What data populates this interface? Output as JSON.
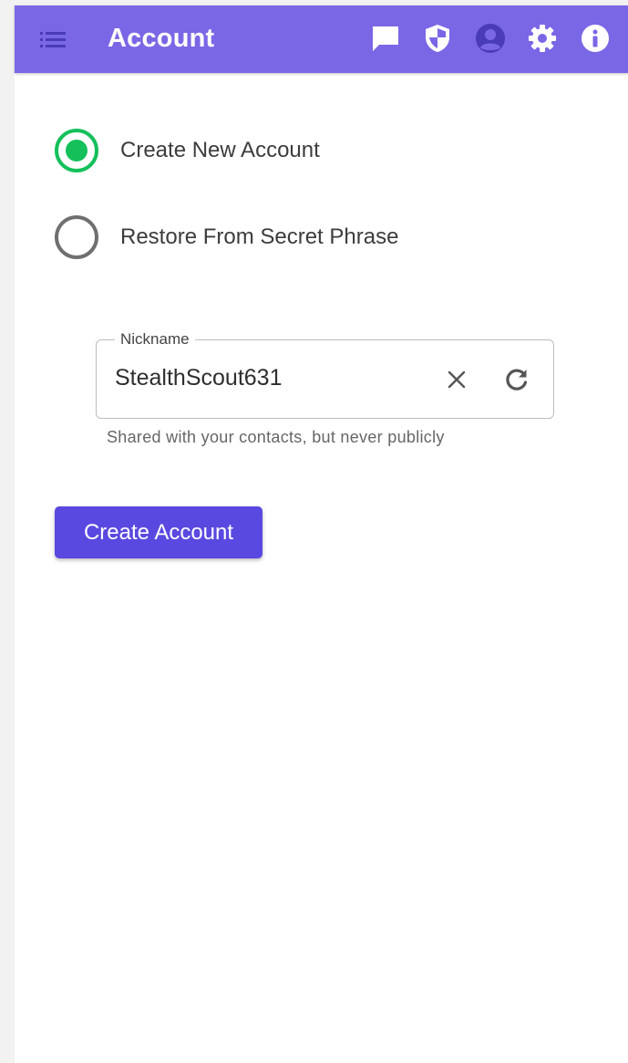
{
  "app_bar": {
    "title": "Account",
    "icons": [
      "menu-icon",
      "chat-icon",
      "shield-icon",
      "account-circle-icon",
      "settings-gear-icon",
      "info-icon"
    ],
    "color": "#7a67e6"
  },
  "account_mode": {
    "options": [
      {
        "label": "Create New Account",
        "selected": true
      },
      {
        "label": "Restore From Secret Phrase",
        "selected": false
      }
    ],
    "selected_color": "#14c05a"
  },
  "nickname_field": {
    "label": "Nickname",
    "value": "StealthScout631",
    "helper_text": "Shared with your contacts, but never publicly",
    "actions": [
      "clear-icon",
      "refresh-icon"
    ]
  },
  "submit": {
    "label": "Create Account",
    "color": "#5a49e0"
  }
}
